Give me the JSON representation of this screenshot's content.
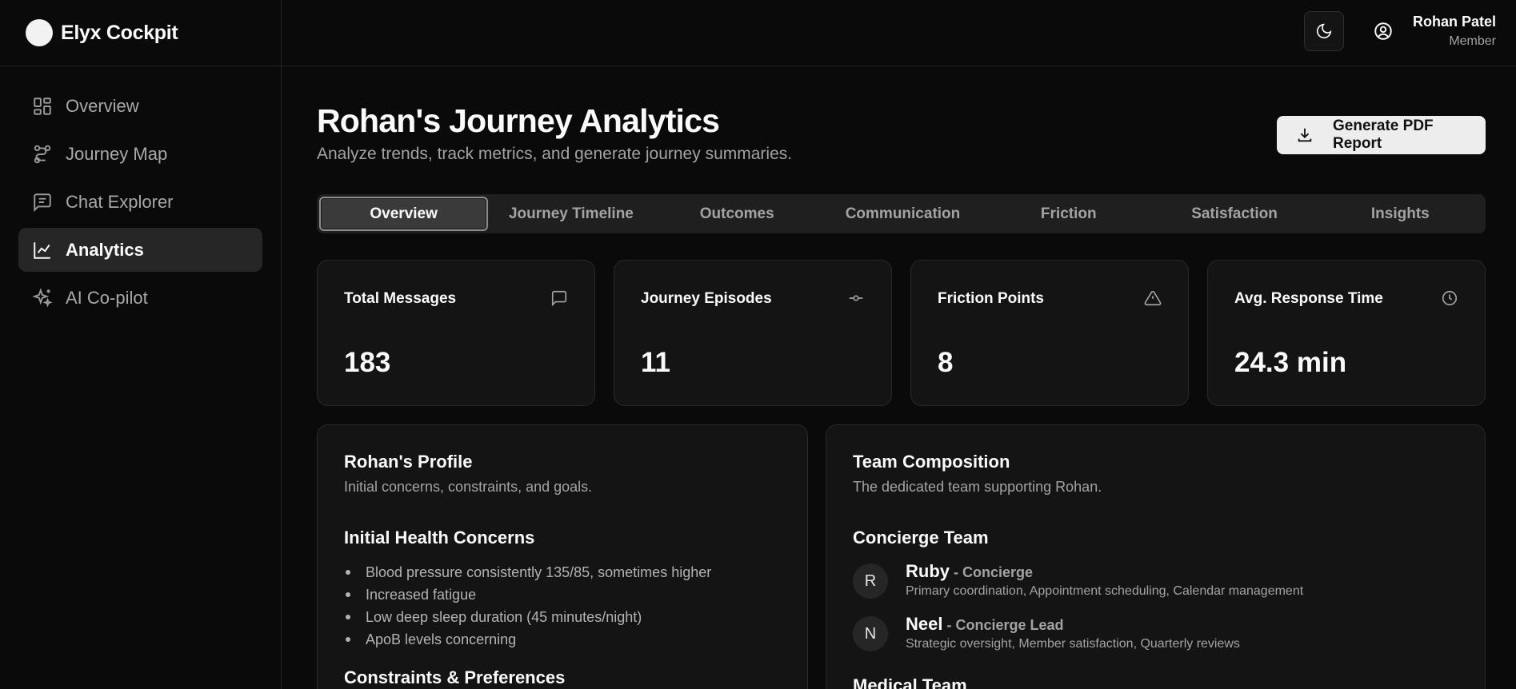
{
  "app": {
    "name": "Elyx Cockpit"
  },
  "sidebar": {
    "items": [
      {
        "label": "Overview",
        "icon": "dashboard-grid-icon"
      },
      {
        "label": "Journey Map",
        "icon": "route-icon"
      },
      {
        "label": "Chat Explorer",
        "icon": "message-square-text-icon"
      },
      {
        "label": "Analytics",
        "icon": "line-chart-icon",
        "active": true
      },
      {
        "label": "AI Co-pilot",
        "icon": "sparkles-icon"
      }
    ]
  },
  "topbar": {
    "theme_icon": "moon-icon",
    "user_icon": "user-circle-icon",
    "user": {
      "name": "Rohan Patel",
      "role": "Member"
    }
  },
  "header": {
    "title": "Rohan's Journey Analytics",
    "subtitle": "Analyze trends, track metrics, and generate journey summaries.",
    "pdf_button": "Generate PDF Report"
  },
  "tabs": [
    {
      "label": "Overview",
      "active": true
    },
    {
      "label": "Journey Timeline"
    },
    {
      "label": "Outcomes"
    },
    {
      "label": "Communication"
    },
    {
      "label": "Friction"
    },
    {
      "label": "Satisfaction"
    },
    {
      "label": "Insights"
    }
  ],
  "stats": [
    {
      "label": "Total Messages",
      "value": "183",
      "icon": "message-square-icon"
    },
    {
      "label": "Journey Episodes",
      "value": "11",
      "icon": "git-commit-icon"
    },
    {
      "label": "Friction Points",
      "value": "8",
      "icon": "alert-triangle-icon"
    },
    {
      "label": "Avg. Response Time",
      "value": "24.3 min",
      "icon": "clock-icon"
    }
  ],
  "profile": {
    "title": "Rohan's Profile",
    "description": "Initial concerns, constraints, and goals.",
    "concerns_heading": "Initial Health Concerns",
    "concerns": [
      "Blood pressure consistently 135/85, sometimes higher",
      "Increased fatigue",
      "Low deep sleep duration (45 minutes/night)",
      "ApoB levels concerning"
    ],
    "constraints_heading": "Constraints & Preferences"
  },
  "team": {
    "title": "Team Composition",
    "description": "The dedicated team supporting Rohan.",
    "concierge_heading": "Concierge Team",
    "members": [
      {
        "initial": "R",
        "name": "Ruby",
        "role": " - Concierge",
        "responsibilities": "Primary coordination, Appointment scheduling, Calendar management"
      },
      {
        "initial": "N",
        "name": "Neel",
        "role": " - Concierge Lead",
        "responsibilities": "Strategic oversight, Member satisfaction, Quarterly reviews"
      }
    ],
    "medical_heading": "Medical Team"
  }
}
